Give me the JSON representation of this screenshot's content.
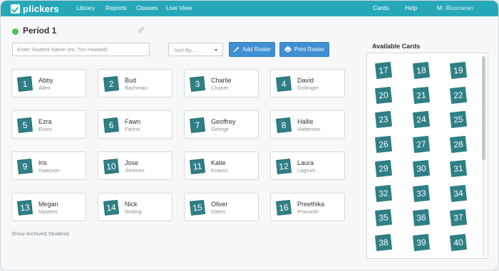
{
  "nav": {
    "logo_text": "plickers",
    "items": [
      "Library",
      "Reports",
      "Classes",
      "Live View"
    ],
    "right": [
      "Cards",
      "Help"
    ],
    "user": "M. Rogowski"
  },
  "header": {
    "class_name": "Period 1",
    "status_color": "#4cc24c"
  },
  "controls": {
    "student_name_placeholder": "Enter Student Name (ex: Tim Howard)",
    "sort_label": "Sort By...",
    "add_roster_label": "Add Roster",
    "print_roster_label": "Print Roster"
  },
  "students": [
    {
      "number": "1",
      "first": "Abby",
      "last": "Allen"
    },
    {
      "number": "2",
      "first": "Bud",
      "last": "Bachman"
    },
    {
      "number": "3",
      "first": "Charlie",
      "last": "Chaser"
    },
    {
      "number": "4",
      "first": "David",
      "last": "Dolfinger"
    },
    {
      "number": "5",
      "first": "Ezra",
      "last": "Ennis"
    },
    {
      "number": "6",
      "first": "Fawn",
      "last": "Farino"
    },
    {
      "number": "7",
      "first": "Geoffrey",
      "last": "George"
    },
    {
      "number": "8",
      "first": "Hallie",
      "last": "Hatterson"
    },
    {
      "number": "9",
      "first": "Iris",
      "last": "Isaacson"
    },
    {
      "number": "10",
      "first": "Jose",
      "last": "Jimenez"
    },
    {
      "number": "11",
      "first": "Katie",
      "last": "Krauss"
    },
    {
      "number": "12",
      "first": "Laura",
      "last": "Lagrum"
    },
    {
      "number": "13",
      "first": "Megan",
      "last": "Masters"
    },
    {
      "number": "14",
      "first": "Nick",
      "last": "Notting"
    },
    {
      "number": "15",
      "first": "Oliver",
      "last": "Oates"
    },
    {
      "number": "16",
      "first": "Preethika",
      "last": "Prasanth"
    }
  ],
  "archived_link": "Show Archived Students",
  "available_cards": {
    "title": "Available Cards",
    "numbers": [
      "17",
      "18",
      "19",
      "20",
      "21",
      "22",
      "23",
      "24",
      "25",
      "26",
      "27",
      "28",
      "29",
      "30",
      "31",
      "32",
      "33",
      "34",
      "35",
      "36",
      "37",
      "38",
      "39",
      "40"
    ]
  },
  "colors": {
    "topbar": "#27a8b9",
    "card_badge": "#2f7f86",
    "button": "#3f8fd2"
  },
  "icons": {
    "edit": "pencil-icon",
    "add_roster": "magic-wand-icon",
    "print_roster": "printer-icon",
    "sort": "chevron-down-icon"
  }
}
